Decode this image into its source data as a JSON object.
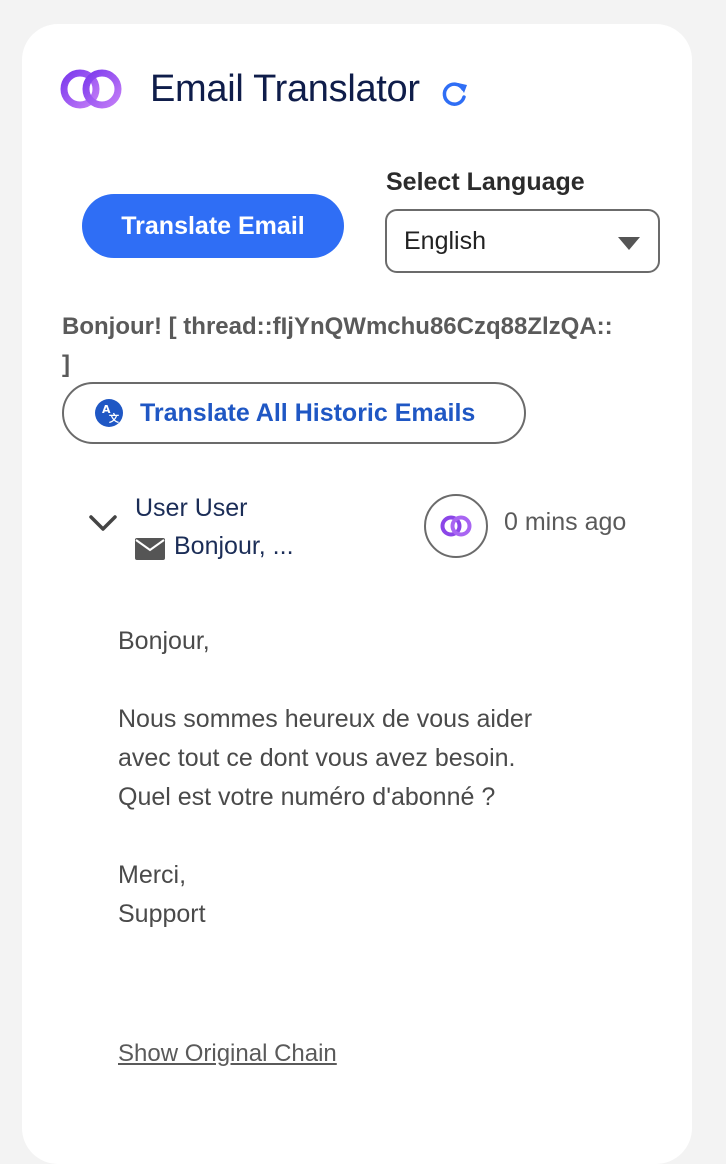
{
  "header": {
    "title": "Email Translator",
    "logo_icon": "linked-rings-logo",
    "refresh_icon": "refresh-icon"
  },
  "toolbar": {
    "translate_button": "Translate Email",
    "language_label": "Select Language",
    "language_selected": "English"
  },
  "thread": {
    "title": "Bonjour! [ thread::fIjYnQWmchu86Czq88ZlzQA:: ]",
    "translate_all_label": "Translate All Historic Emails"
  },
  "email": {
    "sender": "User User",
    "subject": "Bonjour,  ...",
    "time": "0 mins ago",
    "body": {
      "greeting": "Bonjour,",
      "line1": "Nous sommes heureux de vous aider",
      "line2": "avec tout ce dont vous avez besoin.",
      "line3": "Quel est votre numéro d'abonné ?",
      "signoff": "Merci,",
      "signature": "Support"
    }
  },
  "footer": {
    "show_original": "Show Original Chain"
  },
  "colors": {
    "accent": "#2f6ef5",
    "link_blue": "#1f57c4",
    "title_navy": "#0f1d4a",
    "logo_purple": "#8b46e8"
  }
}
